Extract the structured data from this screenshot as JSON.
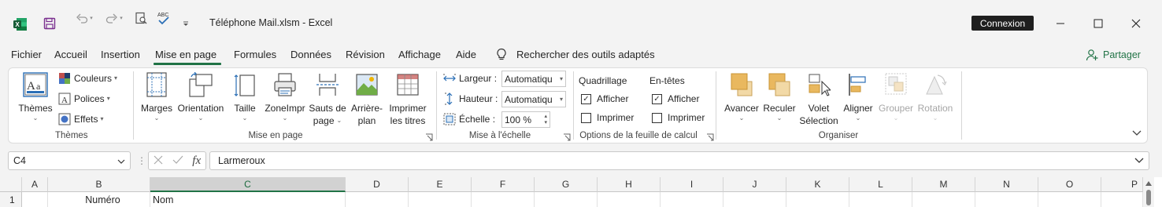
{
  "titlebar": {
    "title": "Téléphone Mail.xlsm  -  Excel",
    "connexion": "Connexion",
    "icons": [
      "excel-logo-icon",
      "save-icon",
      "undo-icon",
      "redo-icon",
      "print-preview-icon",
      "spelling-icon",
      "customize-qat-icon",
      "minimize-icon",
      "maximize-icon",
      "close-icon"
    ]
  },
  "menu": {
    "tabs": [
      "Fichier",
      "Accueil",
      "Insertion",
      "Mise en page",
      "Formules",
      "Données",
      "Révision",
      "Affichage",
      "Aide"
    ],
    "active": "Mise en page",
    "search": "Rechercher des outils adaptés",
    "share": "Partager"
  },
  "ribbon": {
    "themes": {
      "label": "Thèmes",
      "themes_btn": "Thèmes",
      "colors": "Couleurs",
      "fonts": "Polices",
      "effects": "Effets"
    },
    "page_setup": {
      "label": "Mise en page",
      "margins": "Marges",
      "orientation": "Orientation",
      "size": "Taille",
      "print_area": "ZoneImpr",
      "breaks_1": "Sauts de",
      "breaks_2": "page",
      "background_1": "Arrière-",
      "background_2": "plan",
      "print_titles_1": "Imprimer",
      "print_titles_2": "les titres"
    },
    "scale": {
      "label": "Mise à l'échelle",
      "width_label": "Largeur :",
      "width_value": "Automatiqu",
      "height_label": "Hauteur :",
      "height_value": "Automatiqu",
      "scale_label": "Échelle :",
      "scale_value": "100 %"
    },
    "sheet_options": {
      "label": "Options de la feuille de calcul",
      "gridlines": "Quadrillage",
      "headings": "En-têtes",
      "view": "Afficher",
      "print": "Imprimer",
      "gridlines_view": true,
      "gridlines_print": false,
      "headings_view": true,
      "headings_print": false
    },
    "arrange": {
      "label": "Organiser",
      "forward": "Avancer",
      "backward": "Reculer",
      "pane_1": "Volet",
      "pane_2": "Sélection",
      "align": "Aligner",
      "group": "Grouper",
      "rotate": "Rotation"
    }
  },
  "formula_bar": {
    "name_box": "C4",
    "content": "Larmeroux"
  },
  "grid": {
    "columns": [
      "A",
      "B",
      "C",
      "D",
      "E",
      "F",
      "G",
      "H",
      "I",
      "J",
      "K",
      "L",
      "M",
      "N",
      "O",
      "P"
    ],
    "selected_column": "C",
    "row1": {
      "num": "1",
      "b": "Numéro",
      "c": "Nom"
    }
  },
  "colors": {
    "accent": "#217346",
    "ribbon_bg": "#ffffff",
    "chrome_bg": "#f3f3f3"
  }
}
